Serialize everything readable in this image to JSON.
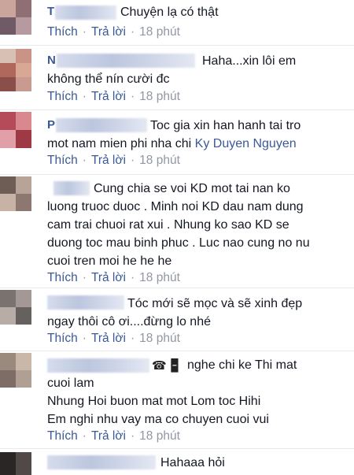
{
  "actions": {
    "like": "Thích",
    "reply": "Trả lời",
    "time": "18 phút"
  },
  "comments": [
    {
      "author_initial": "T",
      "lines": [
        "Chuyện lạ có thật"
      ]
    },
    {
      "author_initial": "N",
      "lines": [
        "Haha...xin lôi em",
        "không thể nín cười đc"
      ]
    },
    {
      "author_initial": "P",
      "lines": [
        "Toc gia xin han hanh tai tro",
        "mot nam mien phi nha chi "
      ],
      "mention": "Ky Duyen Nguyen"
    },
    {
      "author_initial": "",
      "lines": [
        "Cung chia se voi KD mot tai nan ko",
        "luong truoc duoc . Minh noi KD dau nam dung",
        "cam trai chuoi rat xui . Nhung ko sao KD se",
        "duong toc mau binh phuc . Luc nao cung no nu",
        "cuoi tren moi he he he"
      ]
    },
    {
      "author_initial": "",
      "lines": [
        "Tóc mới sẽ mọc và sẽ xinh đẹp",
        "ngay thôi cô ơi....đừng lo nhé"
      ]
    },
    {
      "author_initial": "",
      "icons": "☎ 🁢",
      "lines": [
        "nghe chi ke Thi mat",
        "cuoi lam",
        "Nhung Hoi buon mat mot Lom toc Hihi",
        "Em nghi nhu vay ma co chuyen cuoi vui"
      ]
    },
    {
      "author_initial": "",
      "lines": [
        "Hahaaa hỏi"
      ]
    }
  ]
}
